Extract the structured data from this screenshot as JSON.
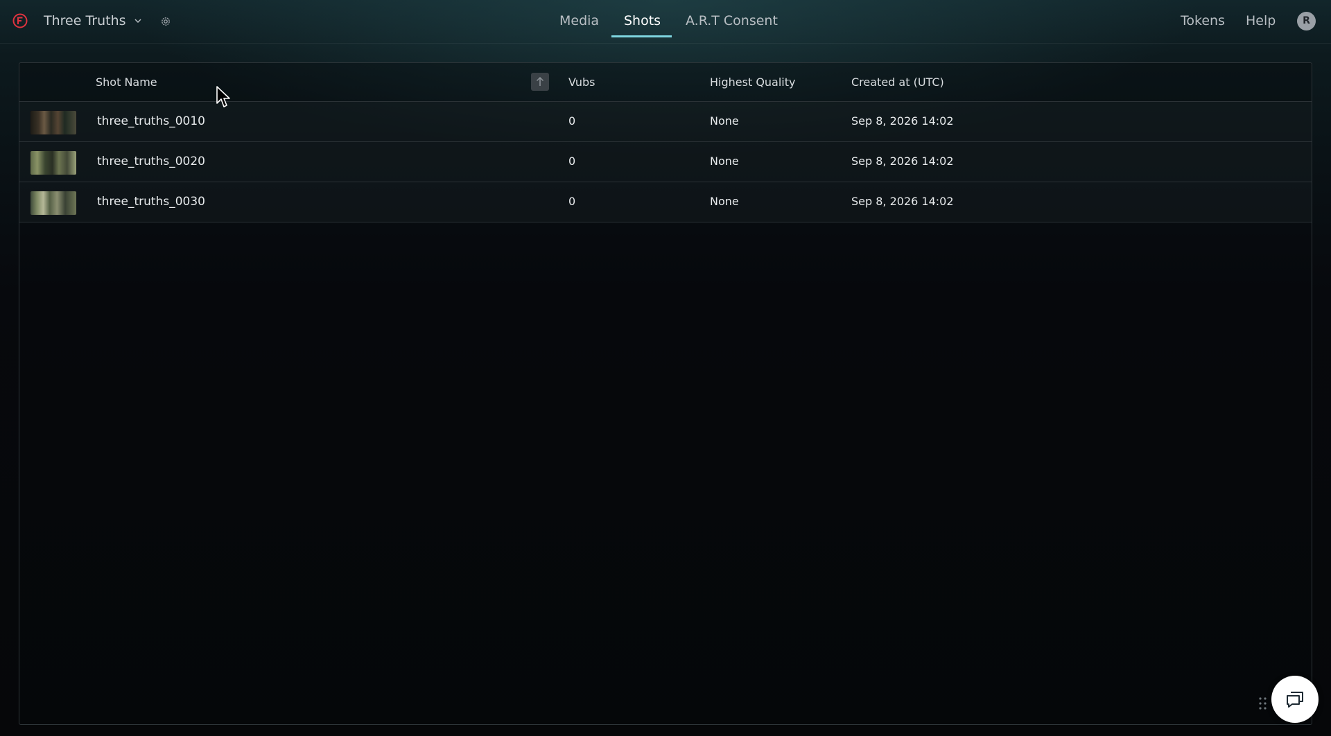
{
  "header": {
    "project_name": "Three Truths",
    "nav_tabs": [
      {
        "label": "Media"
      },
      {
        "label": "Shots",
        "active": true
      },
      {
        "label": "A.R.T Consent"
      }
    ],
    "right_links": [
      "Tokens",
      "Help"
    ],
    "avatar_initial": "R",
    "accent_color": "#7fd6e0",
    "logo_color": "#e0333f"
  },
  "table": {
    "columns": [
      "Shot Name",
      "Vubs",
      "Highest Quality",
      "Created at (UTC)"
    ],
    "sort_icon": "arrow-up-icon",
    "rows": [
      {
        "name": "three_truths_0010",
        "vubs": "0",
        "quality": "None",
        "created": "Sep 8, 2026 14:02"
      },
      {
        "name": "three_truths_0020",
        "vubs": "0",
        "quality": "None",
        "created": "Sep 8, 2026 14:02"
      },
      {
        "name": "three_truths_0030",
        "vubs": "0",
        "quality": "None",
        "created": "Sep 8, 2026 14:02"
      }
    ]
  },
  "widgets": {
    "chat_icon": "chat-bubbles-icon",
    "drag_icon": "drag-handle-icon"
  }
}
